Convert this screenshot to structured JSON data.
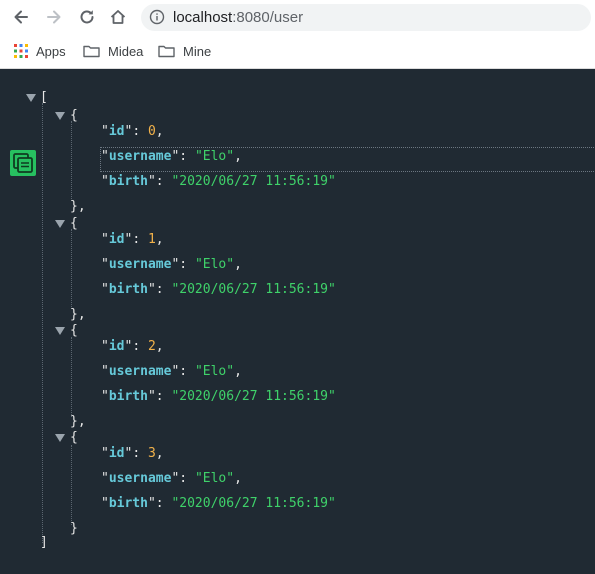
{
  "browser": {
    "url_host": "localhost",
    "url_rest": ":8080/user",
    "bookmarks": [
      {
        "label": "Apps",
        "icon": "apps-grid-icon"
      },
      {
        "label": "Midea",
        "icon": "folder-icon"
      },
      {
        "label": "Mine",
        "icon": "folder-icon"
      }
    ]
  },
  "json": {
    "open_bracket": "[",
    "close_bracket": "]",
    "keys": {
      "id": "id",
      "username": "username",
      "birth": "birth"
    },
    "records": [
      {
        "id": "0",
        "username": "Elo",
        "birth": "2020/06/27 11:56:19"
      },
      {
        "id": "1",
        "username": "Elo",
        "birth": "2020/06/27 11:56:19"
      },
      {
        "id": "2",
        "username": "Elo",
        "birth": "2020/06/27 11:56:19"
      },
      {
        "id": "3",
        "username": "Elo",
        "birth": "2020/06/27 11:56:19"
      }
    ]
  },
  "colors": {
    "background": "#202a33",
    "key": "#66c9d9",
    "number": "#f2b24a",
    "string": "#3fd26a",
    "copy_button": "#27c060"
  }
}
